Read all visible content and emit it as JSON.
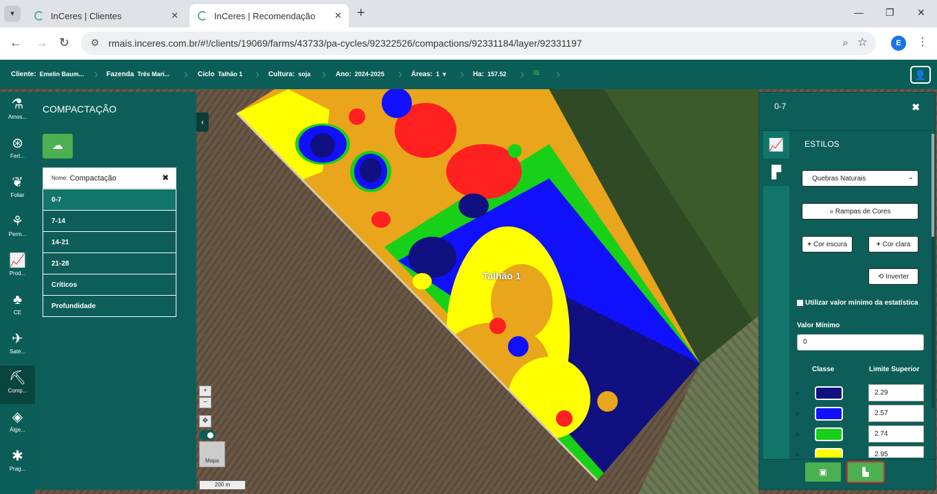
{
  "browser": {
    "tabs": [
      {
        "title": "InCeres | Clientes",
        "active": false
      },
      {
        "title": "InCeres | Recomendação",
        "active": true
      }
    ],
    "url": "rmais.inceres.com.br/#!/clients/19069/farms/43733/pa-cycles/92322526/compactions/92331184/layer/92331197",
    "profile_initial": "E"
  },
  "header": {
    "cliente_label": "Cliente:",
    "cliente_value": "Emelin Baum...",
    "fazenda_label": "Fazenda",
    "fazenda_value": "Três Mari...",
    "ciclo_label": "Ciclo",
    "ciclo_value": "Talhão 1",
    "cultura_label": "Cultura:",
    "cultura_value": "soja",
    "ano_label": "Ano:",
    "ano_value": "2024-2025",
    "areas_label": "Áreas:",
    "areas_value": "1",
    "ha_label": "Ha:",
    "ha_value": "157.52"
  },
  "sidebar": {
    "items": [
      {
        "label": "Amos...",
        "icon": "sample-icon"
      },
      {
        "label": "Fert...",
        "icon": "fertilizer-icon"
      },
      {
        "label": "Foliar",
        "icon": "leaf-icon"
      },
      {
        "label": "Perm...",
        "icon": "plants-icon"
      },
      {
        "label": "Prod...",
        "icon": "chart-line-icon"
      },
      {
        "label": "CE",
        "icon": "sprout-icon"
      },
      {
        "label": "Saté...",
        "icon": "satellite-icon"
      },
      {
        "label": "Comp...",
        "icon": "compaction-icon",
        "active": true
      },
      {
        "label": "Álge...",
        "icon": "layers-icon"
      },
      {
        "label": "Prag...",
        "icon": "bug-icon"
      }
    ]
  },
  "panel": {
    "title": "COMPACTAÇÃO",
    "layer_name_label": "Nome:",
    "layer_name": "Compactação",
    "layers": [
      "0-7",
      "7-14",
      "14-21",
      "21-28",
      "Críticos",
      "Profundidade"
    ]
  },
  "map": {
    "field_label": "Talhão 1",
    "zoom_in": "+",
    "zoom_out": "−",
    "basemap_label": "Mapa",
    "scale": "200 m"
  },
  "styles_panel": {
    "title": "0-7",
    "section_title": "ESTILOS",
    "classification": "Quebras Naturais",
    "ramps_button": "» Rampas de Cores",
    "dark_button": "Cor escura",
    "light_button": "Cor clara",
    "invert_button": "Inverter",
    "use_min_label": "Utilizar valor mínimo da estatística",
    "min_label": "Valor Mínimo",
    "min_value": "0",
    "class_header": "Classe",
    "limit_header": "Limite Superior",
    "classes": [
      {
        "color": "#101080",
        "limit": "2.29"
      },
      {
        "color": "#1010ff",
        "limit": "2.57"
      },
      {
        "color": "#18d018",
        "limit": "2.74"
      },
      {
        "color": "#ffff00",
        "limit": "2.95"
      }
    ]
  }
}
